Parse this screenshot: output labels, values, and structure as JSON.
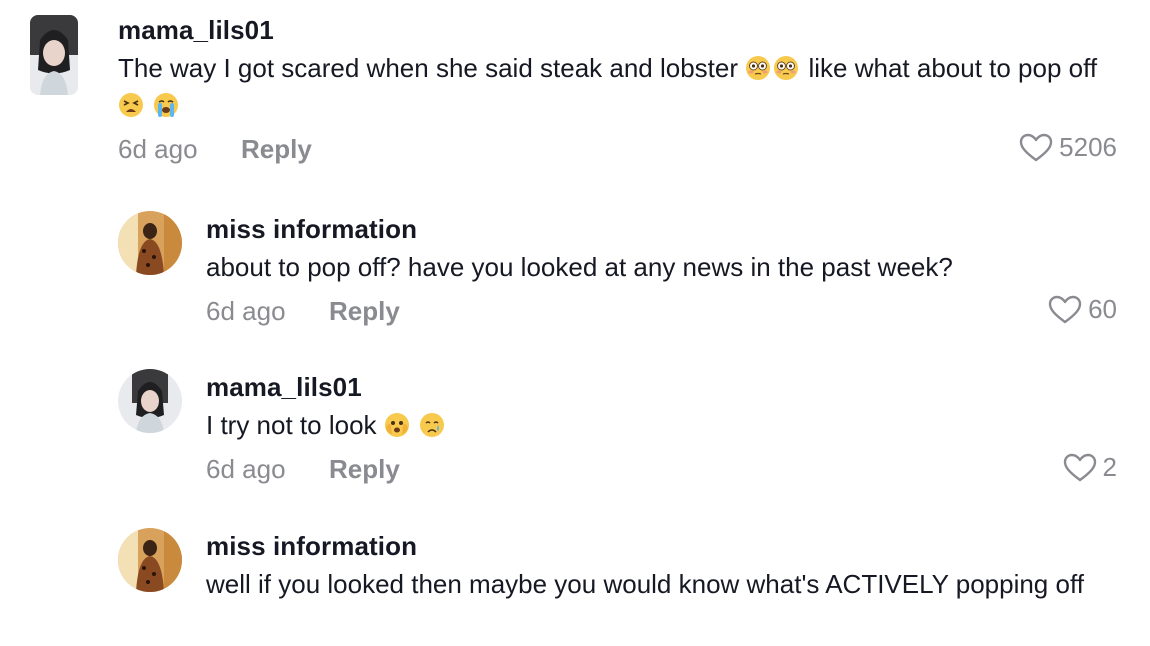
{
  "comments": [
    {
      "username": "mama_lils01",
      "text_before": "The way I got scared when she said steak and lobster",
      "text_middle": "like what about to pop off",
      "time": "6d ago",
      "reply": "Reply",
      "likes": "5206"
    },
    {
      "username": "miss information",
      "text": "about to pop off? have you looked at any news in the past week?",
      "time": "6d ago",
      "reply": "Reply",
      "likes": "60"
    },
    {
      "username": "mama_lils01",
      "text": "I try not to look",
      "time": "6d ago",
      "reply": "Reply",
      "likes": "2"
    },
    {
      "username": "miss information",
      "text": "well if you looked then maybe you would know what's ACTIVELY popping off"
    }
  ],
  "icons": {
    "heart": "heart-outline-icon",
    "emoji_1": "flushed-face-emoji",
    "emoji_2": "tired-face-emoji",
    "emoji_3": "loudly-crying-face-emoji",
    "emoji_4": "face-holding-back-tears-emoji",
    "emoji_5": "crying-face-emoji"
  },
  "colors": {
    "text": "#161823",
    "secondary": "#8a8b91"
  }
}
